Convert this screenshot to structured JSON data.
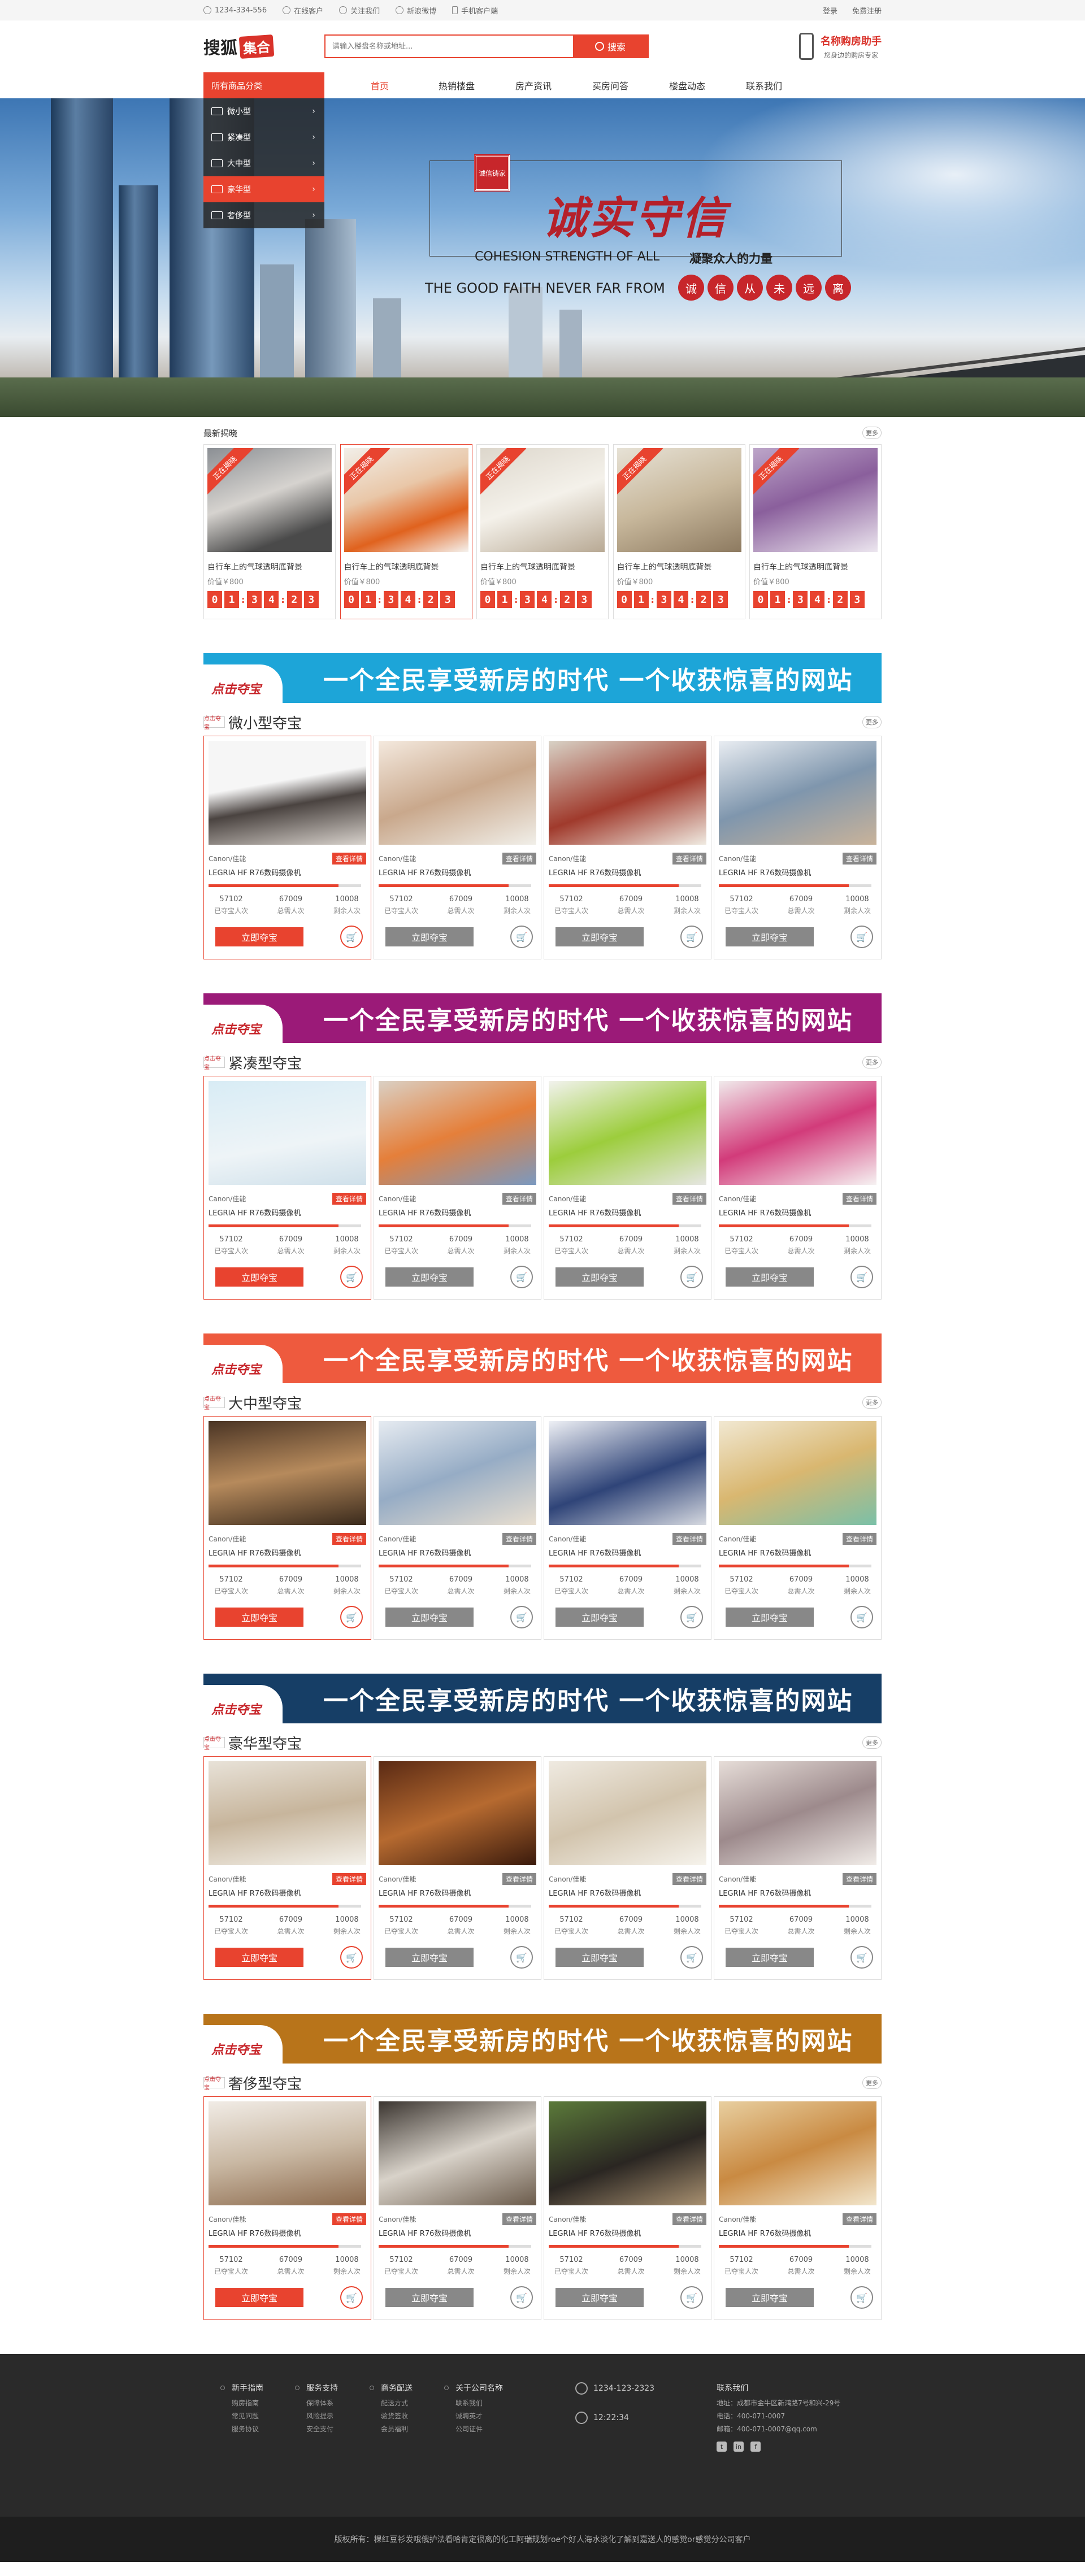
{
  "topbar": {
    "phone": "1234-334-556",
    "links": [
      "在线客户",
      "关注我们",
      "新浪微博",
      "手机客户端"
    ],
    "login": "登录",
    "register": "免费注册"
  },
  "header": {
    "logo_text": "搜狐",
    "logo_badge": "集合",
    "search_placeholder": "请输入楼盘名称或地址...",
    "search_label": "搜索",
    "assist_title": "名称购房助手",
    "assist_sub": "您身边的购房专家"
  },
  "nav": {
    "cat_title": "所有商品分类",
    "items": [
      "首页",
      "热销楼盘",
      "房产资讯",
      "买房问答",
      "楼盘动态",
      "联系我们"
    ]
  },
  "cat_menu": [
    {
      "label": "微小型"
    },
    {
      "label": "紧凑型"
    },
    {
      "label": "大中型"
    },
    {
      "label": "豪华型"
    },
    {
      "label": "奢侈型"
    }
  ],
  "banner": {
    "seal": "诚信铸家",
    "big": "诚实守信",
    "en1": "COHESION STRENGTH OF ALL",
    "cn1": "凝聚众人的力量",
    "en2": "THE GOOD FAITH NEVER FAR FROM",
    "circles": [
      "诚",
      "信",
      "从",
      "未",
      "远",
      "离"
    ]
  },
  "latest": {
    "title": "最新揭晓",
    "more": "更多",
    "items": [
      {
        "ribbon": "正在揭晓",
        "name": "自行车上的气球透明底背景",
        "price": "价值￥800",
        "timer": [
          "0",
          "1",
          "3",
          "4",
          "2",
          "3"
        ]
      },
      {
        "ribbon": "正在揭晓",
        "name": "自行车上的气球透明底背景",
        "price": "价值￥800",
        "timer": [
          "0",
          "1",
          "3",
          "4",
          "2",
          "3"
        ]
      },
      {
        "ribbon": "正在揭晓",
        "name": "自行车上的气球透明底背景",
        "price": "价值￥800",
        "timer": [
          "0",
          "1",
          "3",
          "4",
          "2",
          "3"
        ]
      },
      {
        "ribbon": "正在揭晓",
        "name": "自行车上的气球透明底背景",
        "price": "价值￥800",
        "timer": [
          "0",
          "1",
          "3",
          "4",
          "2",
          "3"
        ]
      },
      {
        "ribbon": "正在揭晓",
        "name": "自行车上的气球透明底背景",
        "price": "价值￥800",
        "timer": [
          "0",
          "1",
          "3",
          "4",
          "2",
          "3"
        ]
      }
    ]
  },
  "banner_slogan": "一个全民享受新房的时代  一个收获惊喜的网站",
  "banner_logo": "点击夺宝",
  "product": {
    "brand": "Canon/佳能",
    "detail": "查看详情",
    "name": "LEGRIA HF R76数码摄像机",
    "v1": "57102",
    "l1": "已夺宝人次",
    "v2": "67009",
    "l2": "总需人次",
    "v3": "10008",
    "l3": "剩余人次",
    "btn": "立即夺宝",
    "more": "更多"
  },
  "sections": [
    {
      "title": "微小型夺宝",
      "color": "#1da5d8"
    },
    {
      "title": "紧凑型夺宝",
      "color": "#9b1a78"
    },
    {
      "title": "大中型夺宝",
      "color": "#ee5a3e"
    },
    {
      "title": "豪华型夺宝",
      "color": "#163e66"
    },
    {
      "title": "奢侈型夺宝",
      "color": "#b8741a"
    }
  ],
  "footer": {
    "cols": [
      {
        "h": "新手指南",
        "items": [
          "购房指南",
          "常见问题",
          "服务协议"
        ]
      },
      {
        "h": "服务支持",
        "items": [
          "保障体系",
          "风险提示",
          "安全支付"
        ]
      },
      {
        "h": "商务配送",
        "items": [
          "配送方式",
          "验货签收",
          "会员福利"
        ]
      },
      {
        "h": "关于公司名称",
        "items": [
          "联系我们",
          "诚聘英才",
          "公司证件"
        ]
      }
    ],
    "phone": "1234-123-2323",
    "time": "12:22:34",
    "contact_title": "联系我们",
    "addr": "地址：成都市金牛区新鸿路7号和兴-29号",
    "tel": "电话：400-071-0007",
    "mail": "邮箱：400-071-0007@qq.com",
    "copyright": "版权所有：棵红豆衫发哦俄护法看哈肯定很离的化工阿瑞规划roe个好人海水淡化了解到嘉送人的感觉or感觉分公司客户"
  }
}
